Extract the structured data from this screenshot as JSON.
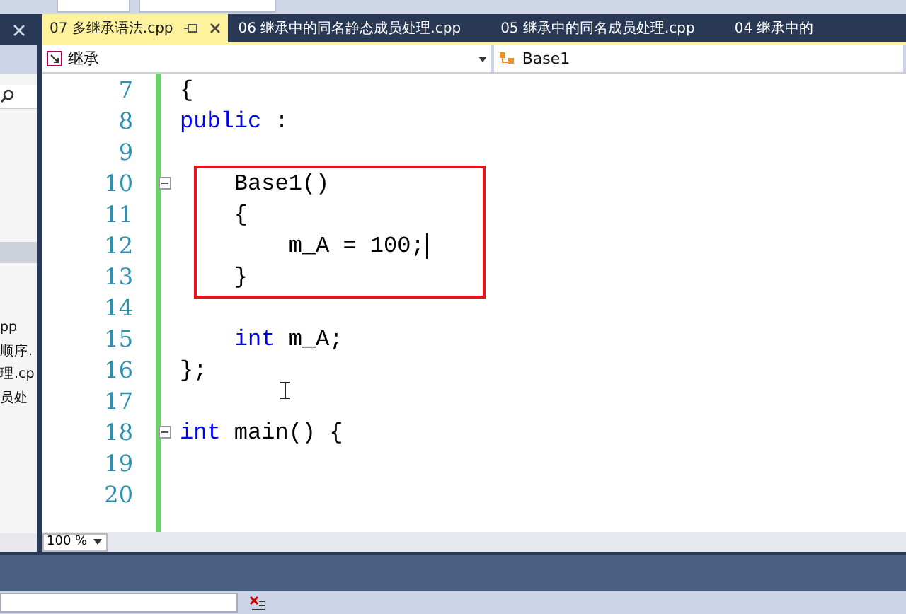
{
  "left_panel": {
    "items": [
      {
        "label": "pp"
      },
      {
        "label": "顺序."
      },
      {
        "label": "理.cp"
      },
      {
        "label": "员处"
      }
    ]
  },
  "tabs": [
    {
      "label": "07 多继承语法.cpp",
      "selected": true
    },
    {
      "label": "06 继承中的同名静态成员处理.cpp",
      "selected": false
    },
    {
      "label": "05 继承中的同名成员处理.cpp",
      "selected": false
    },
    {
      "label": "04 继承中的",
      "selected": false
    }
  ],
  "nav": {
    "scope": "继承",
    "member": "Base1"
  },
  "editor": {
    "lines": [
      {
        "number": "7",
        "tokens": [
          {
            "text": "{",
            "kind": "plain"
          }
        ]
      },
      {
        "number": "8",
        "tokens": [
          {
            "text": "public",
            "kind": "keyword"
          },
          {
            "text": " :",
            "kind": "plain"
          }
        ]
      },
      {
        "number": "9"
      },
      {
        "number": "10",
        "fold": true,
        "boxed": true,
        "tokens": [
          {
            "text": "    Base1()",
            "kind": "plain"
          }
        ]
      },
      {
        "number": "11",
        "boxed": true,
        "tokens": [
          {
            "text": "    {",
            "kind": "plain"
          }
        ]
      },
      {
        "number": "12",
        "boxed": true,
        "cursor": true,
        "tokens": [
          {
            "text": "        m_A = 100;",
            "kind": "plain"
          }
        ]
      },
      {
        "number": "13",
        "boxed": true,
        "tokens": [
          {
            "text": "    }",
            "kind": "plain"
          }
        ]
      },
      {
        "number": "14"
      },
      {
        "number": "15",
        "tokens": [
          {
            "text": "    int",
            "kind": "keyword"
          },
          {
            "text": " m_A;",
            "kind": "plain"
          }
        ]
      },
      {
        "number": "16",
        "tokens": [
          {
            "text": "};",
            "kind": "plain"
          }
        ]
      },
      {
        "number": "17"
      },
      {
        "number": "18",
        "fold": true,
        "tokens": [
          {
            "text": "int",
            "kind": "keyword"
          },
          {
            "text": " main() {",
            "kind": "plain"
          }
        ]
      },
      {
        "number": "19"
      },
      {
        "number": "20"
      }
    ],
    "zoom": "100 %"
  }
}
